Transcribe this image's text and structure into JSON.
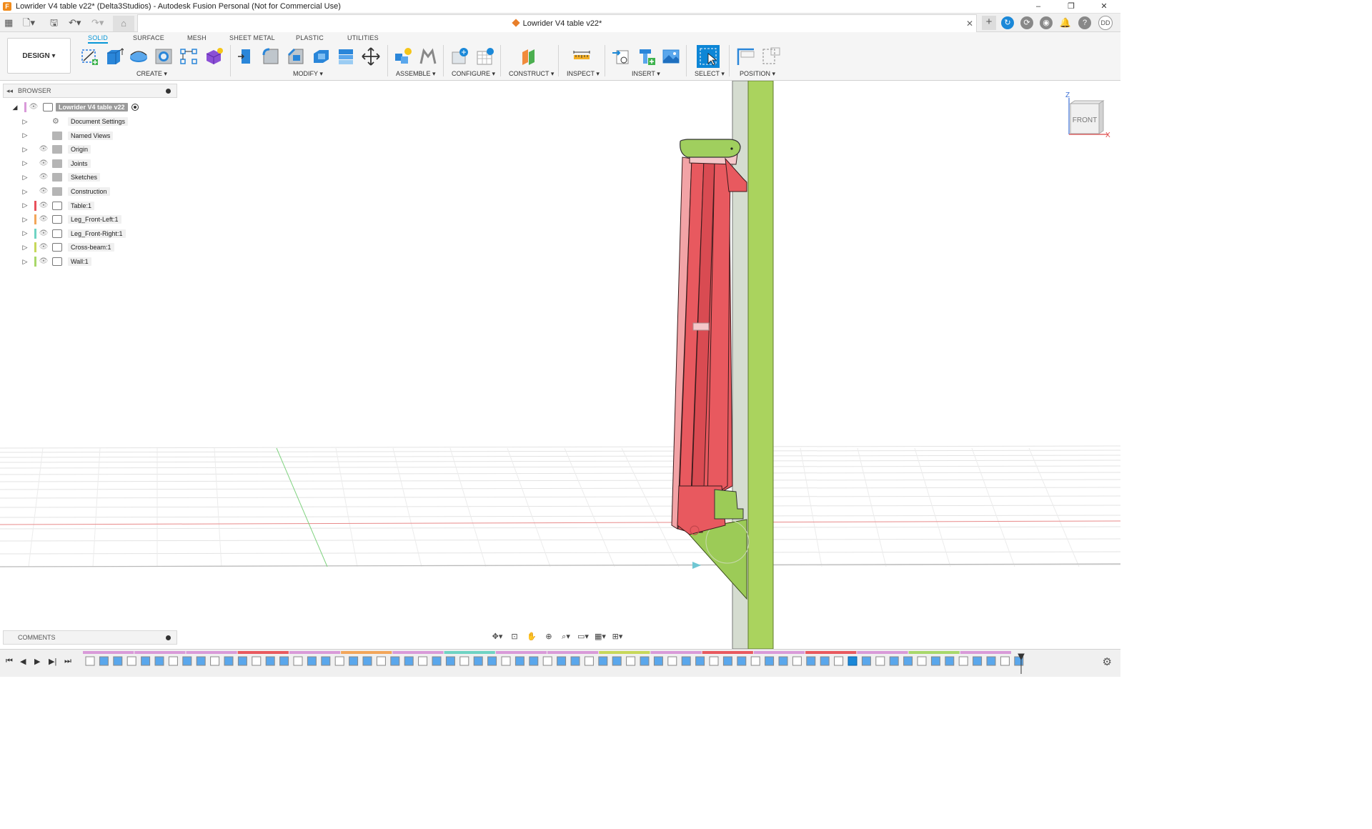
{
  "window": {
    "title": "Lowrider V4 table v22* (Delta3Studios) - Autodesk Fusion Personal (Not for Commercial Use)",
    "app_logo": "F",
    "controls": [
      "–",
      "❐",
      "✕"
    ]
  },
  "tabbar": {
    "document_tab": "Lowrider V4 table v22*",
    "user_initials": "DD"
  },
  "ribbon": {
    "workspace": "DESIGN",
    "tabs": [
      "SOLID",
      "SURFACE",
      "MESH",
      "SHEET METAL",
      "PLASTIC",
      "UTILITIES"
    ],
    "active_tab": "SOLID",
    "groups": [
      "CREATE",
      "MODIFY",
      "ASSEMBLE",
      "CONFIGURE",
      "CONSTRUCT",
      "INSPECT",
      "INSERT",
      "SELECT",
      "POSITION"
    ]
  },
  "browser": {
    "title": "BROWSER",
    "root": "Lowrider V4 table v22",
    "items": [
      {
        "label": "Document Settings",
        "icon": "gear-icon",
        "color": ""
      },
      {
        "label": "Named Views",
        "icon": "folder-icon",
        "color": ""
      },
      {
        "label": "Origin",
        "icon": "folder-icon",
        "color": ""
      },
      {
        "label": "Joints",
        "icon": "folder-icon",
        "color": ""
      },
      {
        "label": "Sketches",
        "icon": "folder-icon",
        "color": ""
      },
      {
        "label": "Construction",
        "icon": "folder-icon",
        "color": ""
      },
      {
        "label": "Table:1",
        "icon": "component-icon",
        "color": "#e8505b"
      },
      {
        "label": "Leg_Front-Left:1",
        "icon": "component-icon",
        "color": "#f2a65a"
      },
      {
        "label": "Leg_Front-Right:1",
        "icon": "component-icon",
        "color": "#6fd3c3"
      },
      {
        "label": "Cross-beam:1",
        "icon": "component-icon",
        "color": "#c7d85a"
      },
      {
        "label": "Wall:1",
        "icon": "component-icon",
        "color": "#a8d86a"
      }
    ]
  },
  "comments": {
    "title": "COMMENTS"
  },
  "viewcube": {
    "face": "FRONT",
    "axis_z": "Z",
    "axis_x": "X"
  },
  "colors": {
    "accent": "#0696d7",
    "table_body": "#e8595f",
    "wall": "#a9d15c",
    "bracket": "#9ccb57"
  }
}
